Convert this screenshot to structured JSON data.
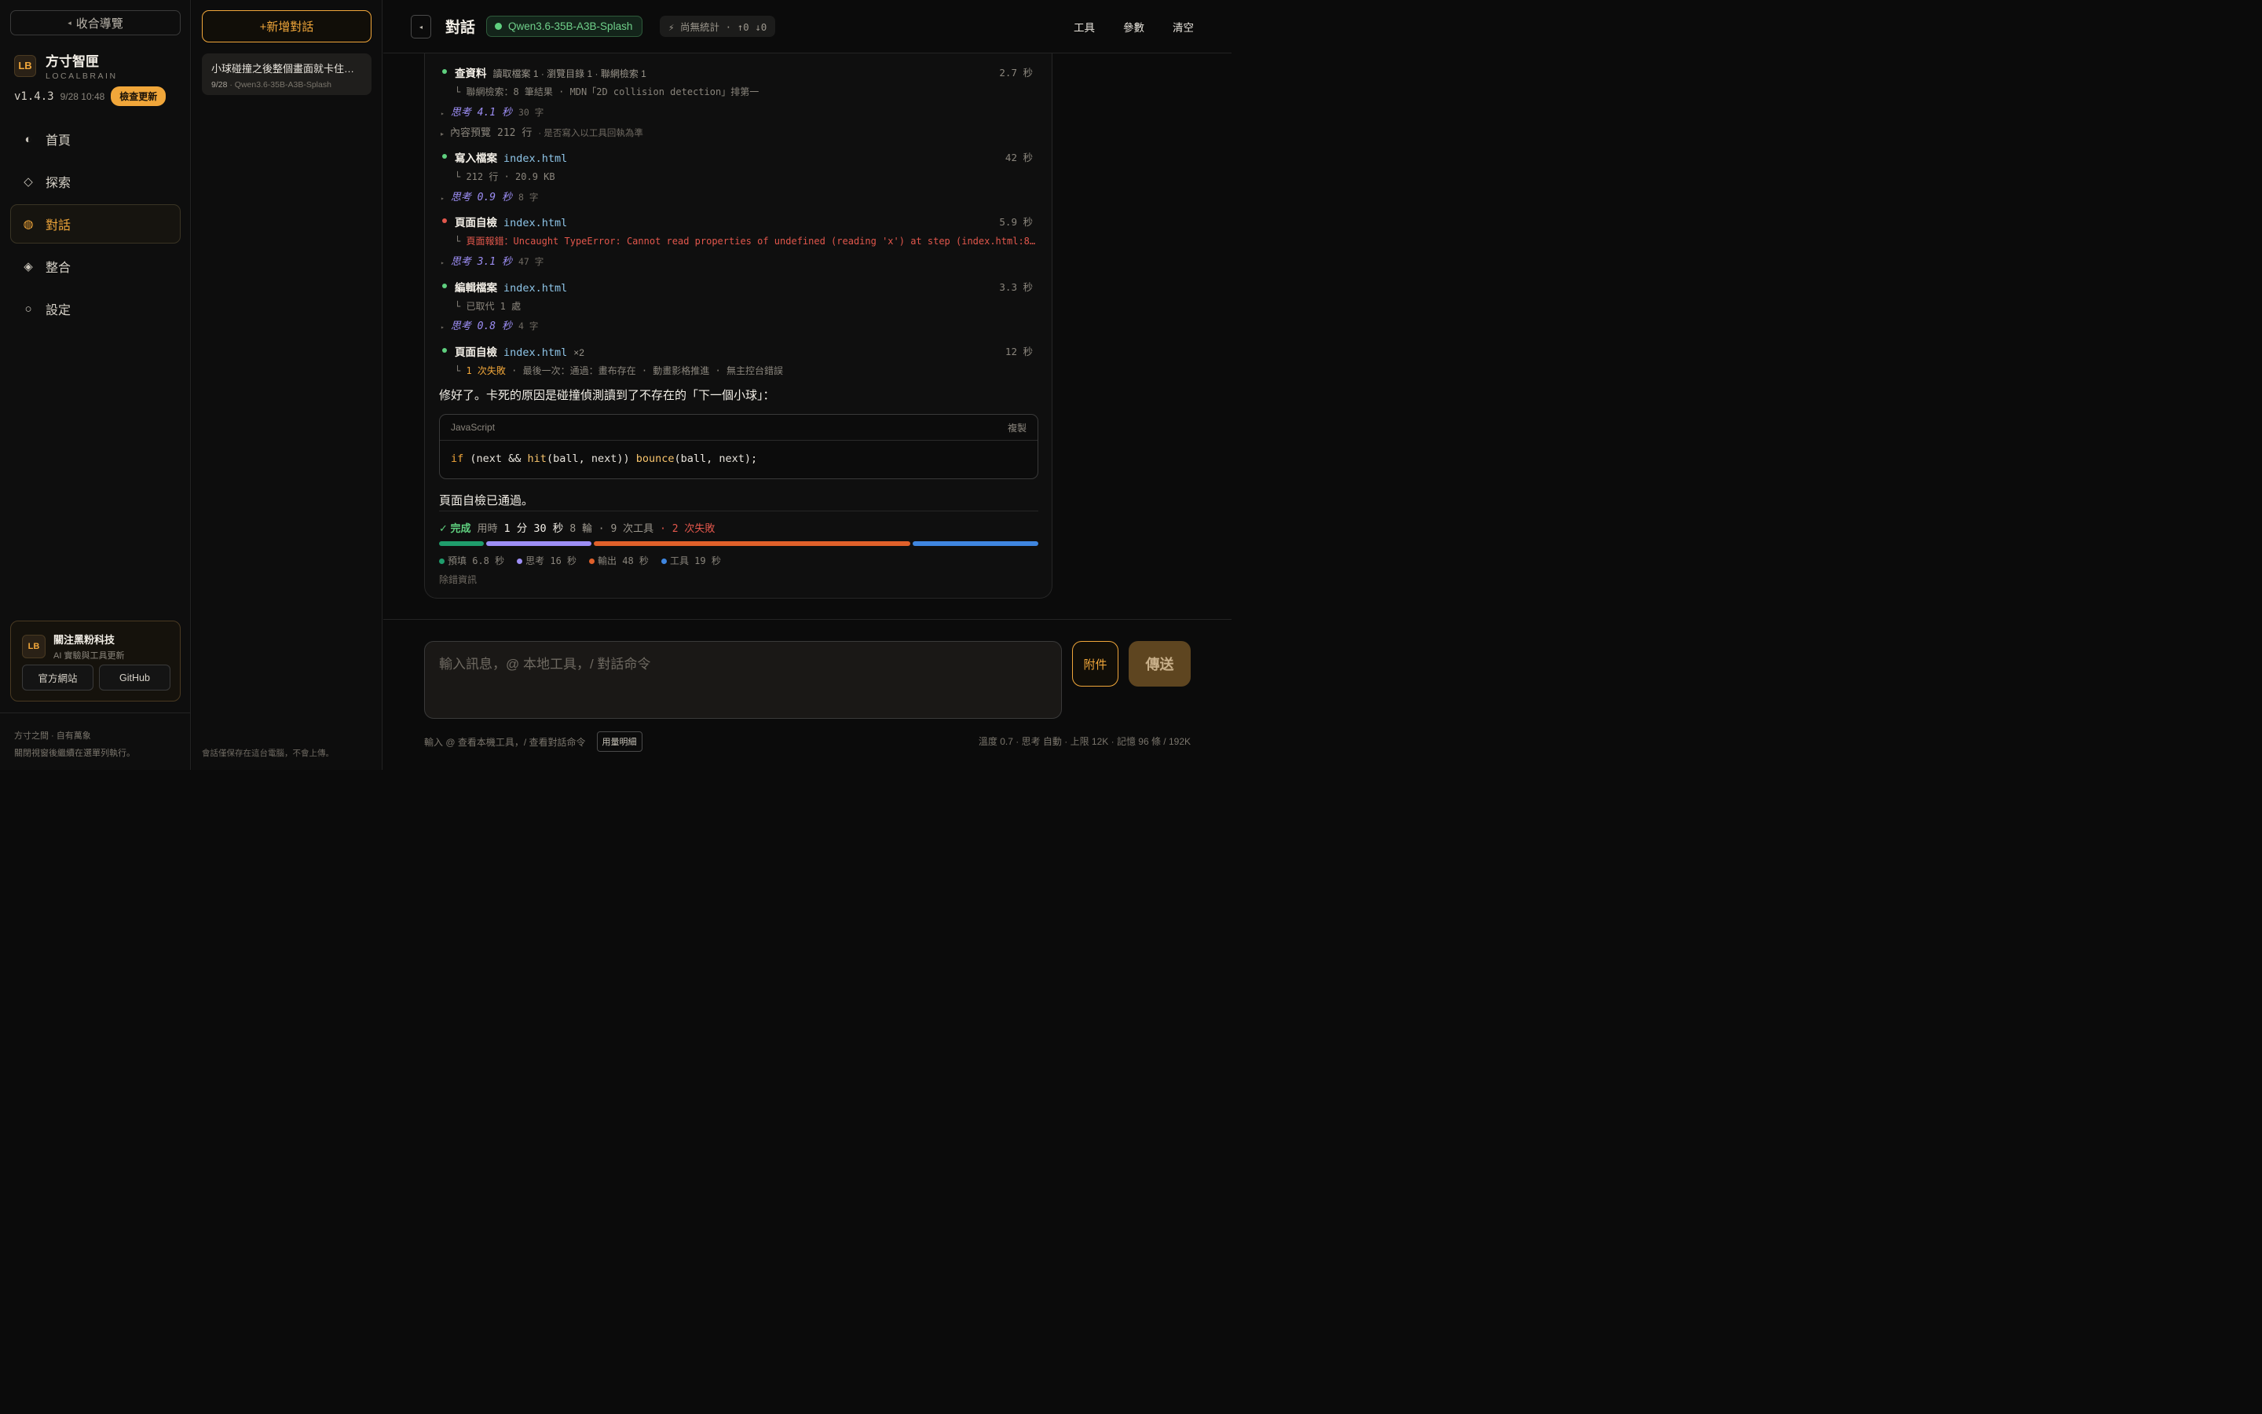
{
  "sidebar": {
    "collapse_label": "收合導覽",
    "brand_logo": "LB",
    "brand_name": "方寸智匣",
    "brand_sub": "LOCALBRAIN",
    "version": "v1.4.3",
    "version_date": "9/28 10:48",
    "update_label": "檢查更新",
    "nav": [
      {
        "label": "首頁",
        "icon": "◐"
      },
      {
        "label": "探索",
        "icon": "◇"
      },
      {
        "label": "對話",
        "icon": "◍"
      },
      {
        "label": "整合",
        "icon": "◈"
      },
      {
        "label": "設定",
        "icon": "○"
      }
    ],
    "follow": {
      "logo": "LB",
      "title": "關注黑粉科技",
      "subtitle": "AI 實驗與工具更新",
      "site_label": "官方網站",
      "github_label": "GitHub"
    },
    "footer_line1": "方寸之間 · 自有萬象",
    "footer_line2": "關閉視窗後繼續在選單列執行。"
  },
  "convs": {
    "new_label": "+新增對話",
    "items": [
      {
        "title": "小球碰撞之後整個畫面就卡住了，幫我看看",
        "date": "9/28",
        "model": "· Qwen3.6-35B-A3B-Splash"
      }
    ],
    "footer": "會話僅保存在這台電腦，不會上傳。"
  },
  "topbar": {
    "toggle_icon": "◂",
    "title": "對話",
    "model": "Qwen3.6-35B-A3B-Splash",
    "stats": "⚡ 尚無統計 · ↑0 ↓0",
    "actions": [
      "工具",
      "參數",
      "清空"
    ]
  },
  "chat": {
    "steps": [
      {
        "label": "查資料",
        "file": "",
        "meta": "讀取檔案 1 · 瀏覽目錄 1 · 聯網檢索 1",
        "time": "2.7 秒",
        "sub": "聯網檢索：8 筆結果 · MDN「2D collision detection」排第一"
      },
      {
        "label": "寫入檔案",
        "file": "index.html",
        "meta": "",
        "time": "42 秒",
        "sub": "212 行 · 20.9 KB"
      },
      {
        "label": "頁面自檢",
        "file": "index.html",
        "meta": "",
        "time": "5.9 秒",
        "sub_prefix": "頁面報錯：",
        "sub": "Uncaught TypeError: Cannot read properties of undefined (reading 'x') at step (index.html:8…"
      },
      {
        "label": "編輯檔案",
        "file": "index.html",
        "meta": "",
        "time": "3.3 秒",
        "sub": "已取代 1 處"
      },
      {
        "label": "頁面自檢",
        "file": "index.html",
        "meta": "×2",
        "time": "12 秒",
        "sub_warn": "1 次失敗",
        "sub": "· 最後一次：通過：畫布存在 · 動畫影格推進 · 無主控台錯誤"
      }
    ],
    "thinks": [
      {
        "t": "思考 4.1 秒",
        "c": "30 字"
      },
      {
        "t": "思考 0.9 秒",
        "c": "8 字"
      },
      {
        "t": "思考 3.1 秒",
        "c": "47 字"
      },
      {
        "t": "思考 0.8 秒",
        "c": "4 字"
      }
    ],
    "preview": {
      "label": "內容預覽",
      "count": "212 行",
      "note": "· 是否寫入以工具回執為準"
    },
    "answer1": "修好了。卡死的原因是碰撞偵測讀到了不存在的「下一個小球」：",
    "code_lang": "JavaScript",
    "code_copy": "複製",
    "answer2": "頁面自檢已通過。",
    "done": {
      "ok": "✓ 完成",
      "used": "用時",
      "duration": "1 分 30 秒",
      "rounds": "8 輪 · 9 次工具",
      "fail": "· 2 次失敗"
    },
    "timing": [
      {
        "label": "預填 6.8 秒",
        "value": 6.8,
        "color": "#1f9d6c"
      },
      {
        "label": "思考 16 秒",
        "value": 16,
        "color": "#9d8ef5"
      },
      {
        "label": "輸出 48 秒",
        "value": 48,
        "color": "#e0602a"
      },
      {
        "label": "工具 19 秒",
        "value": 19,
        "color": "#3f86e0"
      }
    ],
    "debug": "除錯資訊"
  },
  "composer": {
    "placeholder": "輸入訊息，@ 本地工具，/ 對話命令",
    "attach_label": "附件",
    "send_label": "傳送",
    "hint": "輸入 @ 查看本機工具，/ 查看對話命令",
    "usage_label": "用量明細",
    "status": "溫度 0.7 · 思考 自動 · 上限 12K · 記憶 96 條 / 192K"
  }
}
